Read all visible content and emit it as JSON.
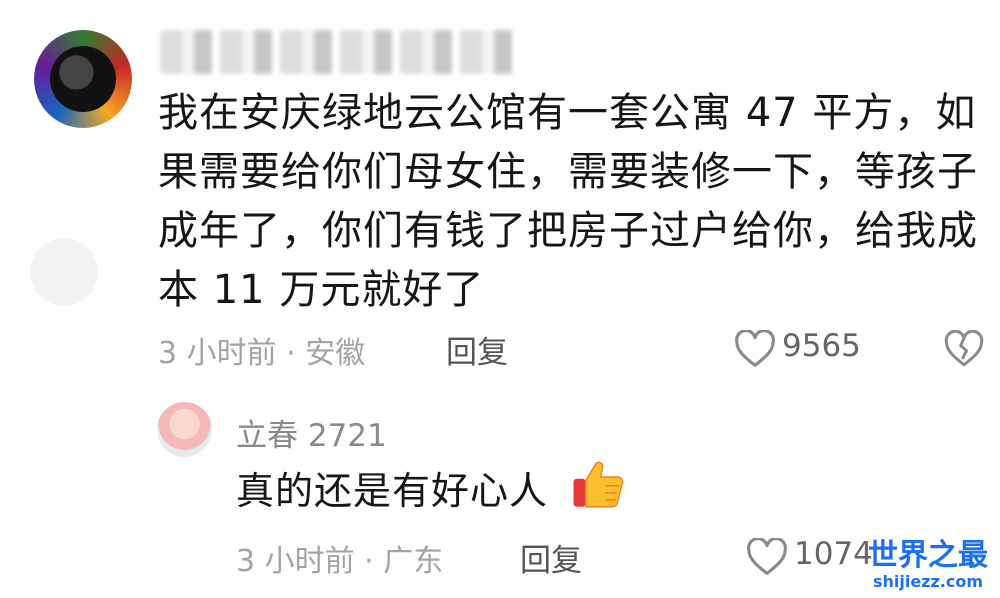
{
  "comment": {
    "text": "我在安庆绿地云公馆有一套公寓 47 平方，如果需要给你们母女住，需要装修一下，等孩子成年了，你们有钱了把房子过户给你，给我成本 11 万元就好了",
    "meta": "3 小时前 · 安徽",
    "reply_label": "回复",
    "like_count": "9565",
    "icons": {
      "like": "heart-outline-icon",
      "dislike": "broken-heart-icon"
    }
  },
  "reply": {
    "username": "立春 2721",
    "text": "真的还是有好心人",
    "emoji": "thumbs-up-icon",
    "meta": "3 小时前 · 广东",
    "reply_label": "回复",
    "like_count": "1074"
  },
  "watermark": {
    "title": "世界之最",
    "url": "shijiezz.com"
  },
  "colors": {
    "text": "#161616",
    "meta": "#a3a3a3",
    "watermark": "#1b6ff5",
    "background": "#ffffff"
  }
}
